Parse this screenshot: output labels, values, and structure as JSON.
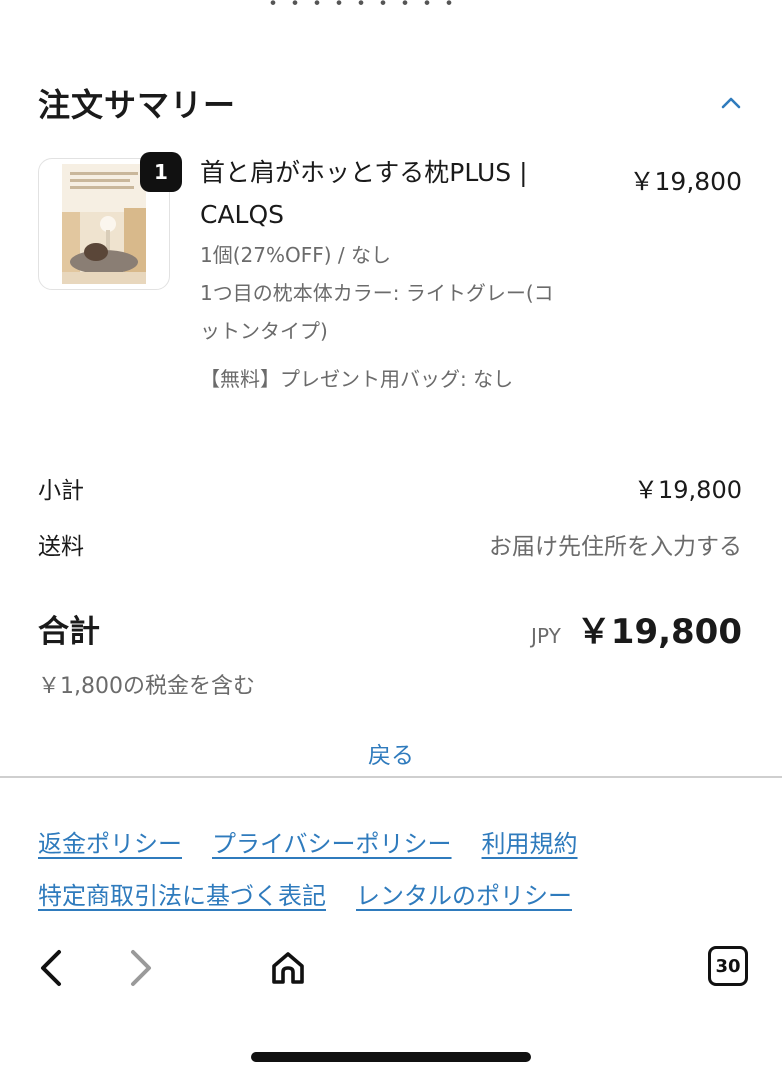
{
  "summary": {
    "title": "注文サマリー",
    "toggle_icon": "chevron-up-icon"
  },
  "item": {
    "quantity_badge": "1",
    "name_line1": "首と肩がホッとする枕PLUS |",
    "name_line2": "CALQS",
    "quantity_discount": "1個(27%OFF) / なし",
    "color_option_line1": "1つ目の枕本体カラー: ライトグレー(コ",
    "color_option_line2": "ットンタイプ)",
    "gift_bag_option": "【無料】プレゼント用バッグ: なし",
    "price": "￥19,800"
  },
  "totals": {
    "subtotal_label": "小計",
    "subtotal_value": "￥19,800",
    "shipping_label": "送料",
    "shipping_value": "お届け先住所を入力する",
    "total_label": "合計",
    "currency": "JPY",
    "total_value": "￥19,800",
    "tax_note": "￥1,800の税金を含む"
  },
  "back_link": "戻る",
  "policies": {
    "refund": "返金ポリシー",
    "privacy": "プライバシーポリシー",
    "terms": "利用規約",
    "commerce_law": "特定商取引法に基づく表記",
    "rental": "レンタルのポリシー"
  },
  "browser": {
    "tab_count": "30"
  },
  "colors": {
    "link": "#2f7bbd",
    "text": "#1a1a1a",
    "muted": "#6b6b6b"
  }
}
